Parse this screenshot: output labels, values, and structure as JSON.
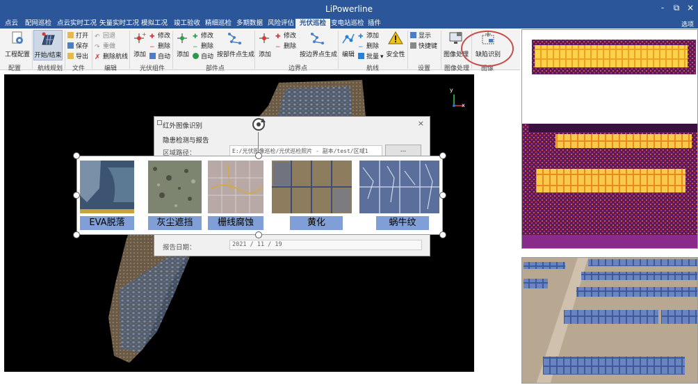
{
  "window": {
    "title": "LiPowerline",
    "minimize": "-",
    "restore": "⧉",
    "close": "×",
    "options": "选项"
  },
  "tabs": [
    {
      "label": "点云"
    },
    {
      "label": "配网巡检"
    },
    {
      "label": "点云实时工况"
    },
    {
      "label": "矢量实时工况"
    },
    {
      "label": "模拟工况"
    },
    {
      "label": "竣工验收"
    },
    {
      "label": "精细巡检"
    },
    {
      "label": "多期数据"
    },
    {
      "label": "风险评估"
    },
    {
      "label": "光伏巡检"
    },
    {
      "label": "变电站巡检"
    },
    {
      "label": "插件"
    }
  ],
  "ribbon": {
    "project_config": "工程配置",
    "start_end": "开始/结束",
    "open": "打开",
    "save": "保存",
    "export": "导出",
    "undo": "回退",
    "redo": "重做",
    "delete_route": "删除航线",
    "pv_add": "添加",
    "pv_modify": "修改",
    "pv_delete": "删除",
    "pv_auto": "自动",
    "part_add": "添加",
    "part_modify": "修改",
    "part_delete": "删除",
    "part_auto": "自动",
    "by_part_gen": "按部件点生成",
    "bound_add": "添加",
    "bound_modify": "修改",
    "bound_delete": "删除",
    "by_bound_gen": "按边界点生成",
    "edit": "编辑",
    "route_add": "添加",
    "route_delete": "删除",
    "batch": "批量",
    "safety": "安全性",
    "display": "显示",
    "shortcut": "快捷键",
    "image_process": "图像处理",
    "defect_recog": "缺陷识别"
  },
  "groups": {
    "config": "配置",
    "route_plan": "航线规划",
    "file": "文件",
    "edit": "编辑",
    "pv_component": "光伏组件",
    "part_point": "部件点",
    "boundary_point": "边界点",
    "route": "航线",
    "settings": "设置",
    "image_process": "图像处理",
    "image": "图像"
  },
  "axis": {
    "y": "y",
    "x": "x"
  },
  "dialog": {
    "title": "红外图像识别",
    "close": "×",
    "section": "隐患检测与报告",
    "path_label": "区域路径：",
    "path_value": "E:/光伏图像巡检/光伏巡检照片 - 副本/test/区域1",
    "browse": "...",
    "date_label": "报告日期：",
    "date_value": "2021 / 11 / 19"
  },
  "defects": [
    {
      "label": "EVA脱落"
    },
    {
      "label": "灰尘遮挡"
    },
    {
      "label": "栅线腐蚀"
    },
    {
      "label": "黄化"
    },
    {
      "label": "蜗牛纹"
    }
  ],
  "colors": {
    "title_bar": "#2b579a",
    "ribbon": "#f3f3f3",
    "defect_label_bg": "#7f9fd6",
    "highlight_circle": "#c84b4b"
  }
}
